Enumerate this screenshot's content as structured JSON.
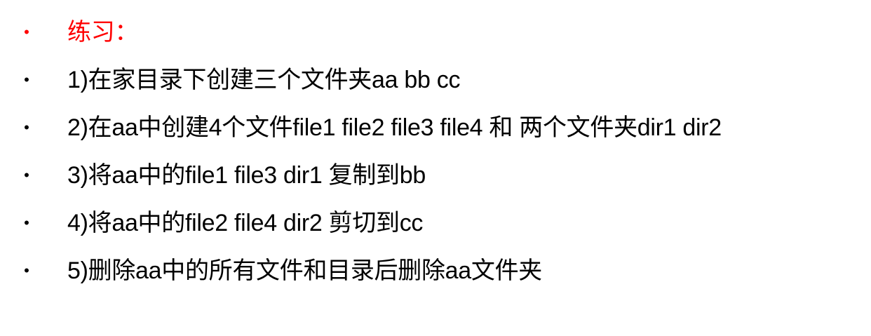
{
  "heading": {
    "bullet": "•",
    "text": "练习：",
    "color": "#ff0000"
  },
  "items": [
    {
      "bullet": "•",
      "text": "1)在家目录下创建三个文件夹aa bb cc"
    },
    {
      "bullet": "•",
      "text": "2)在aa中创建4个文件file1 file2 file3 file4 和 两个文件夹dir1 dir2"
    },
    {
      "bullet": "•",
      "text": "3)将aa中的file1 file3 dir1 复制到bb"
    },
    {
      "bullet": "•",
      "text": "4)将aa中的file2 file4 dir2 剪切到cc"
    },
    {
      "bullet": "•",
      "text": "5)删除aa中的所有文件和目录后删除aa文件夹"
    }
  ],
  "colors": {
    "text": "#000000",
    "heading": "#ff0000",
    "background": "#ffffff"
  }
}
